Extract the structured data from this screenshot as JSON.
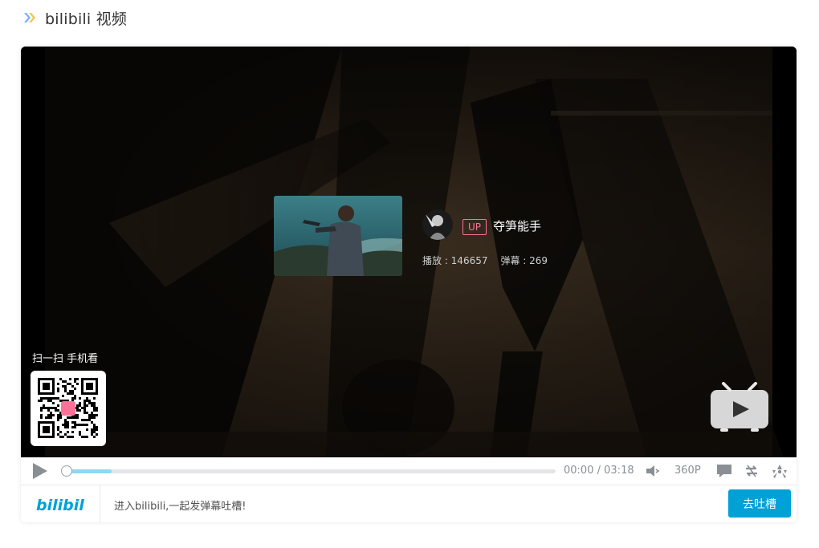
{
  "header": {
    "title": "bilibili 视频",
    "logo_icon": "bilibili-chevron-icon"
  },
  "video": {
    "up": {
      "tag": "UP",
      "name": "夺笋能手"
    },
    "stats": {
      "plays_label": "播放 : 146657",
      "danmaku_label": "弹幕 : 269"
    },
    "scan_label": "扫一扫 手机看",
    "progress_fraction": 0.0,
    "buffer_fraction": 0.1
  },
  "controls": {
    "current_time": "00:00",
    "separator": "/",
    "duration": "03:18",
    "quality": "360P",
    "icons": [
      "play-icon",
      "volume-icon",
      "danmaku-icon",
      "loop-icon",
      "radiation-icon"
    ]
  },
  "bottom": {
    "logo_text": "bilibili",
    "prompt": "进入bilibili,一起发弹幕吐槽!",
    "send_label": "去吐槽"
  },
  "colors": {
    "accent": "#00a1d6",
    "pink": "#fb7299",
    "buffer": "#8ed8f2"
  }
}
